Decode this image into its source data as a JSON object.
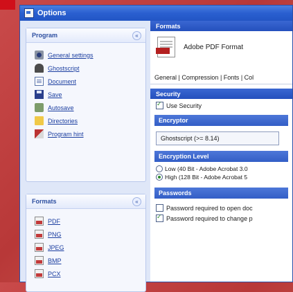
{
  "window": {
    "title": "Options"
  },
  "programs": {
    "heading": "Program",
    "collapse": "«",
    "items": [
      {
        "label": "General settings",
        "icon": "gear-icon"
      },
      {
        "label": "Ghostscript",
        "icon": "ghost-icon"
      },
      {
        "label": "Document",
        "icon": "document-icon"
      },
      {
        "label": "Save",
        "icon": "save-icon"
      },
      {
        "label": "Autosave",
        "icon": "autosave-icon"
      },
      {
        "label": "Directories",
        "icon": "folder-icon"
      },
      {
        "label": "Program hint",
        "icon": "hint-icon"
      }
    ]
  },
  "formats": {
    "heading": "Formats",
    "collapse": "«",
    "items": [
      {
        "label": "PDF",
        "icon": "pdf-icon"
      },
      {
        "label": "PNG",
        "icon": "png-icon"
      },
      {
        "label": "JPEG",
        "icon": "jpeg-icon"
      },
      {
        "label": "BMP",
        "icon": "bmp-icon"
      },
      {
        "label": "PCX",
        "icon": "pcx-icon"
      }
    ]
  },
  "right": {
    "format_header": "Formats",
    "format_name": "Adobe PDF Format",
    "tabs": [
      "General",
      "Compression",
      "Fonts",
      "Col"
    ],
    "security_header": "Security",
    "use_security": "Use Security",
    "encryptor_header": "Encryptor",
    "encryptor_value": "Ghostscript (>= 8.14)",
    "encryption_level_header": "Encryption Level",
    "low_bit": "Low (40 Bit - Adobe Acrobat 3.0",
    "high_bit": "High (128 Bit - Adobe Acrobat 5",
    "passwords_header": "Passwords",
    "pw_open": "Password required to open doc",
    "pw_change": "Password required to change p"
  }
}
